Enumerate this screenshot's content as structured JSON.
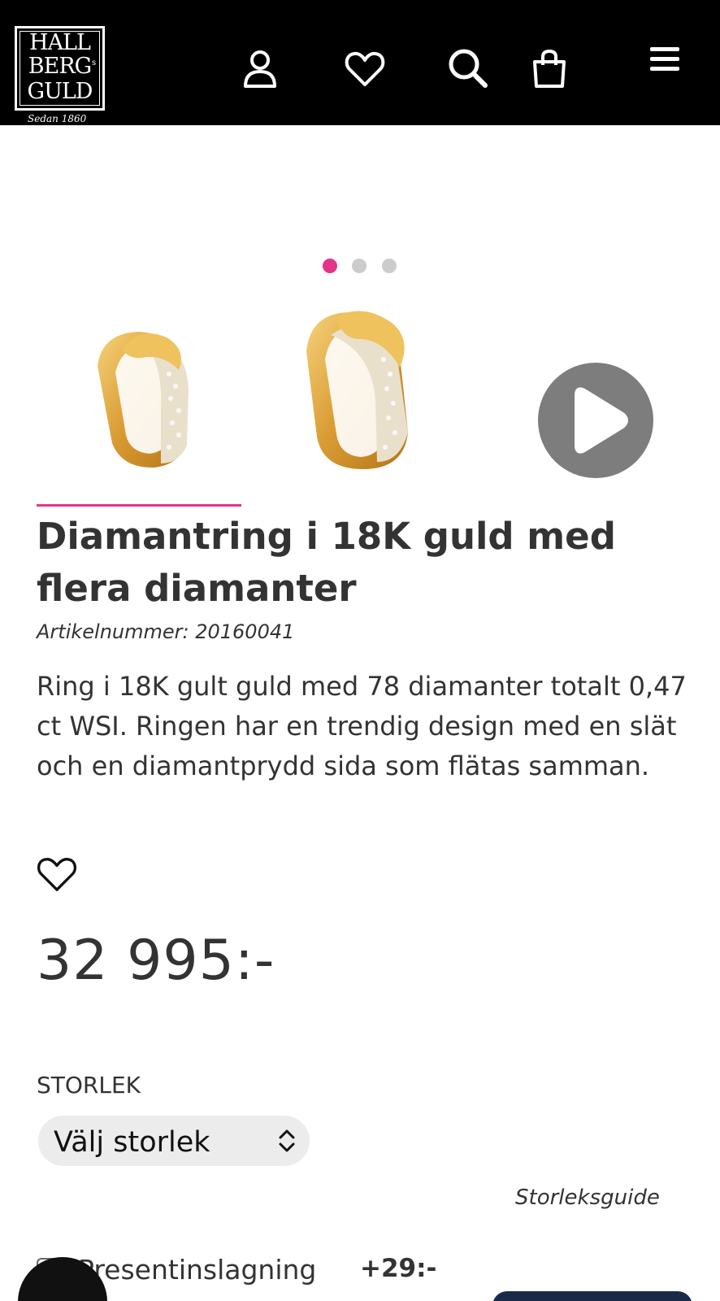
{
  "header": {
    "logo": {
      "line1": "HALL",
      "line2": "BERG",
      "line3": "GULD",
      "small": "s",
      "tagline": "Sedan 1860"
    },
    "icons": [
      "user-icon",
      "heart-icon",
      "search-icon",
      "bag-icon",
      "menu-icon"
    ]
  },
  "carousel": {
    "dots": 3,
    "active_index": 0,
    "thumbnails": [
      "ring-image",
      "ring-image",
      "video-play"
    ]
  },
  "product": {
    "title": "Diamantring i 18K guld med flera diamanter",
    "article_number": "Artikelnummer: 20160041",
    "description": "Ring i 18K gult guld med 78 diamanter totalt 0,47 ct WSI. Ringen har en trendig design med en slät och en diamantprydd sida som flätas samman.",
    "price": "32 995:-"
  },
  "size": {
    "label": "STORLEK",
    "selected": "Välj storlek",
    "guide_link": "Storleksguide"
  },
  "gift": {
    "label": "Presentinslagning",
    "price": "+29:-"
  },
  "colors": {
    "accent": "#e6338a",
    "header_bg": "#000000",
    "text": "#333333"
  }
}
